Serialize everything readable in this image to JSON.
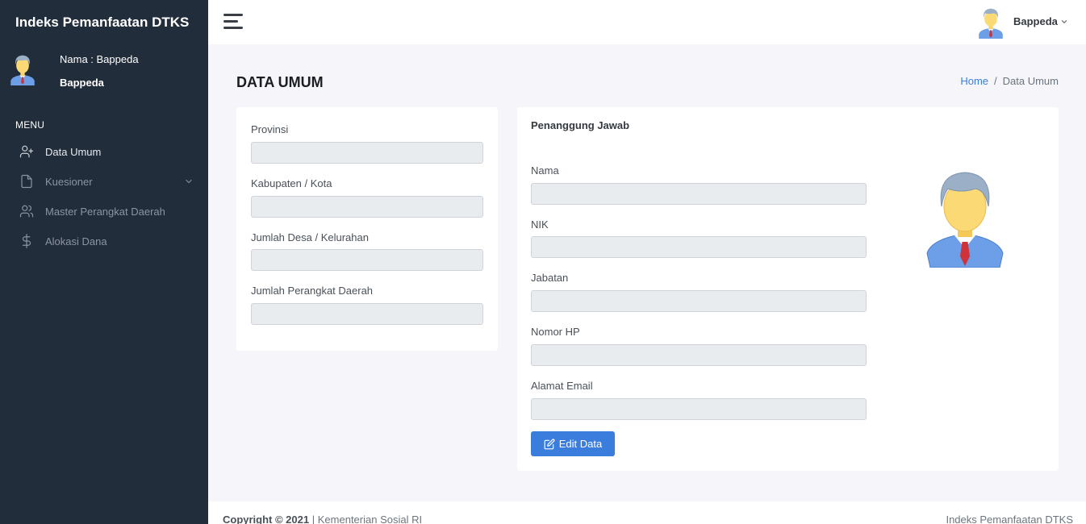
{
  "app": {
    "brand": "Indeks Pemanfaatan DTKS"
  },
  "sidebar": {
    "user_name": "Nama : Bappeda",
    "user_role": "Bappeda",
    "menu_title": "MENU",
    "items": [
      {
        "label": "Data Umum",
        "icon": "user-plus-icon"
      },
      {
        "label": "Kuesioner",
        "icon": "file-icon"
      },
      {
        "label": "Master Perangkat Daerah",
        "icon": "users-icon"
      },
      {
        "label": "Alokasi Dana",
        "icon": "dollar-icon"
      }
    ]
  },
  "topbar": {
    "user": "Bappeda"
  },
  "page": {
    "title": "DATA UMUM"
  },
  "breadcrumb": {
    "home": "Home",
    "current": "Data Umum",
    "separator": "/"
  },
  "left_card": {
    "fields": [
      {
        "label": "Provinsi",
        "value": ""
      },
      {
        "label": "Kabupaten / Kota",
        "value": ""
      },
      {
        "label": "Jumlah Desa / Kelurahan",
        "value": ""
      },
      {
        "label": "Jumlah Perangkat Daerah",
        "value": ""
      }
    ]
  },
  "right_card": {
    "title": "Penanggung Jawab",
    "fields": [
      {
        "label": "Nama",
        "value": ""
      },
      {
        "label": "NIK",
        "value": ""
      },
      {
        "label": "Jabatan",
        "value": ""
      },
      {
        "label": "Nomor HP",
        "value": ""
      },
      {
        "label": "Alamat Email",
        "value": ""
      }
    ],
    "edit_button": "Edit Data"
  },
  "footer": {
    "copyright": "Copyright © 2021",
    "separator": "|",
    "org": "Kementerian Sosial RI",
    "right": "Indeks Pemanfaatan DTKS"
  },
  "colors": {
    "sidebar_bg": "#222d3b",
    "primary": "#3b7ddd",
    "page_bg": "#f5f5fa"
  }
}
